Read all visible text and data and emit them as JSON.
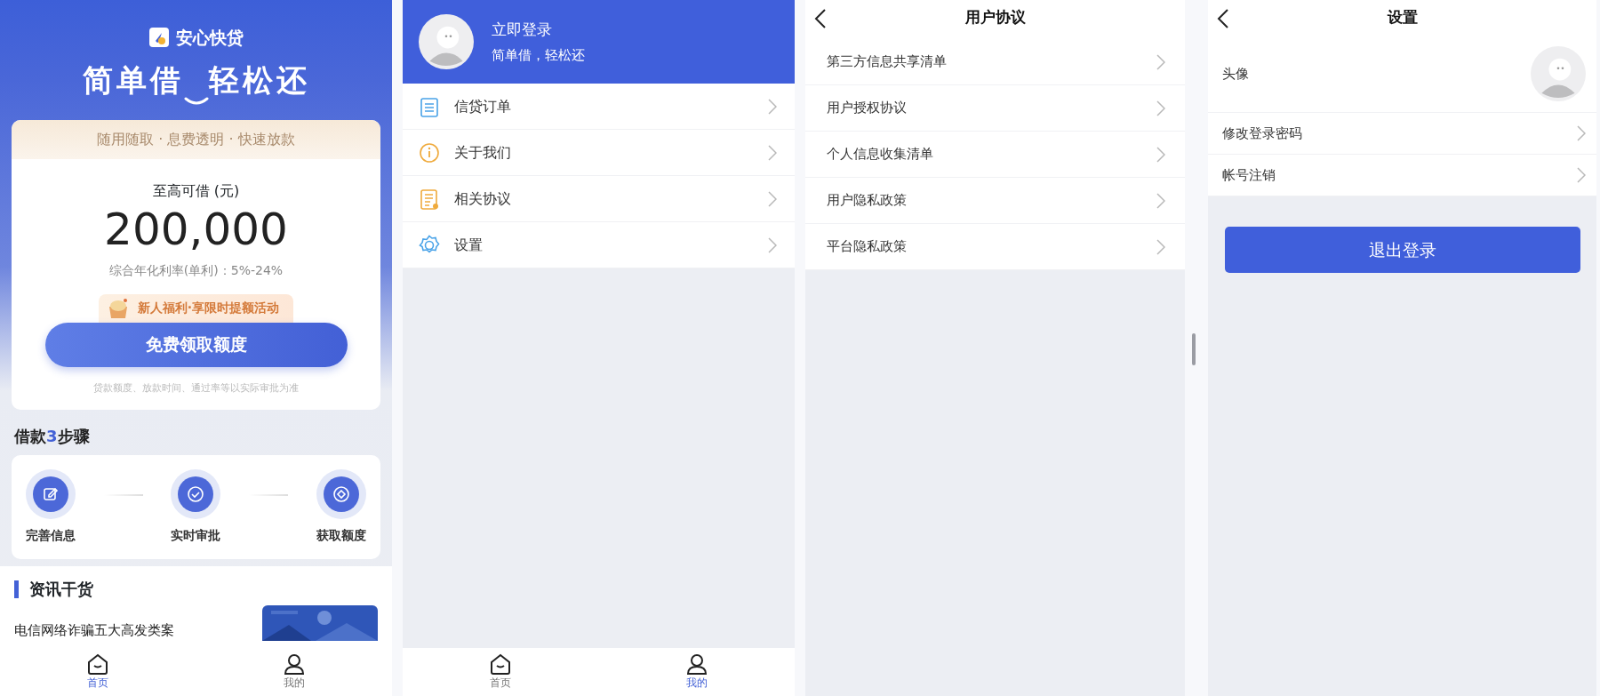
{
  "home": {
    "brand": "安心快贷",
    "slogan_left": "简单借",
    "slogan_right": "轻松还",
    "tagline": "随用随取 · 息费透明 · 快速放款",
    "amount_label": "至高可借 (元)",
    "amount": "200,000",
    "rate": "综合年化利率(单利)：5%-24%",
    "promo": "新人福利·享限时提额活动",
    "cta": "免费领取额度",
    "disclaimer": "贷款额度、放款时间、通过率等以实际审批为准",
    "steps_title": "借款**3**步骤",
    "steps": [
      {
        "label": "完善信息",
        "kind": "edit"
      },
      {
        "label": "实时审批",
        "kind": "check"
      },
      {
        "label": "获取额度",
        "kind": "eye"
      }
    ],
    "news_title": "资讯干货",
    "news": [
      {
        "title": "电信网络诈骗五大高发类案",
        "kind": "picture"
      }
    ],
    "tab_bar": [
      {
        "label": "首页",
        "kind": "home",
        "selected": true
      },
      {
        "label": "我的",
        "kind": "user",
        "selected": false
      }
    ]
  },
  "mine": {
    "login": "立即登录",
    "subtitle": "简单借，轻松还",
    "menu": [
      {
        "label": "信贷订单",
        "kind": "list"
      },
      {
        "label": "关于我们",
        "kind": "info"
      },
      {
        "label": "相关协议",
        "kind": "document"
      },
      {
        "label": "设置",
        "kind": "settings"
      }
    ],
    "tab_bar": [
      {
        "label": "首页",
        "kind": "home",
        "selected": false
      },
      {
        "label": "我的",
        "kind": "user",
        "selected": true
      }
    ]
  },
  "agreements": {
    "title": "用户协议",
    "items": [
      {
        "label": "第三方信息共享清单"
      },
      {
        "label": "用户授权协议"
      },
      {
        "label": "个人信息收集清单"
      },
      {
        "label": "用户隐私政策"
      },
      {
        "label": "平台隐私政策"
      }
    ]
  },
  "settings": {
    "title": "设置",
    "items": [
      {
        "label": "头像",
        "kind": "avatar"
      },
      {
        "label": "修改登录密码",
        "kind": "link"
      },
      {
        "label": "帐号注销",
        "kind": "link"
      }
    ],
    "logout": "退出登录"
  }
}
